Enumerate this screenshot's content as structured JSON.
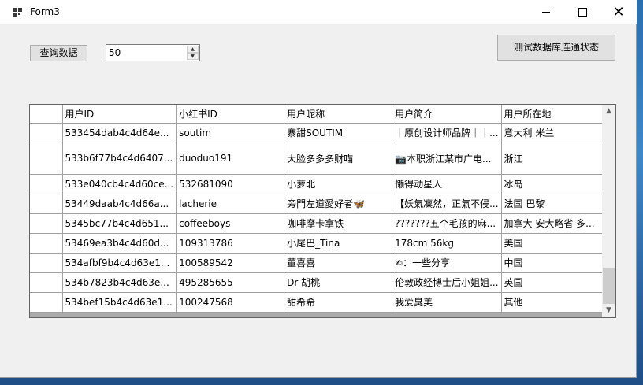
{
  "window": {
    "title": "Form3",
    "controls": {
      "minimize": "—",
      "maximize": "☐",
      "close": "✕"
    }
  },
  "toolbar": {
    "query_label": "查询数据",
    "count_value": "50",
    "test_label": "测试数据库连通状态"
  },
  "grid": {
    "columns": [
      "用户ID",
      "小红书ID",
      "用户昵称",
      "用户简介",
      "用户所在地"
    ],
    "rows": [
      [
        "533454dab4c4d64e...",
        "soutim",
        "寨甜SOUTIM",
        "｜原创设计师品牌｜｜...",
        "意大利  米兰"
      ],
      [
        "533b6f77b4c4d6407...",
        "duoduo191",
        "大脸多多多财喵",
        "📷本职浙江某市广电...",
        "浙江"
      ],
      [
        "533e040cb4c4d60ce...",
        "532681090",
        "小萝北",
        "懒得动星人",
        "冰岛"
      ],
      [
        "53449daab4c4d66a...",
        "lacherie",
        "旁門左道愛好者🦋",
        "【妖氣凜然，正氣不侵...",
        "法国  巴黎"
      ],
      [
        "5345bc77b4c4d651...",
        "coffeeboys",
        "咖啡摩卡拿铁",
        "???????五个毛孩的麻...",
        "加拿大  安大略省  多..."
      ],
      [
        "53469ea3b4c4d60d...",
        "109313786",
        "小尾巴_Tina",
        "178cm 56kg",
        "美国"
      ],
      [
        "534afbf9b4c4d63e1...",
        "100589542",
        "董喜喜",
        "✍：一些分享",
        "中国"
      ],
      [
        "534b7823b4c4d63e...",
        "495285655",
        "Dr 胡桃",
        "伦敦政经博士后小姐姐...",
        "英国"
      ],
      [
        "534bef15b4c4d63e1...",
        "100247568",
        "甜希希",
        "我爱臭美",
        "其他"
      ]
    ]
  },
  "scrollbar": {
    "up": "▲",
    "down": "▼"
  }
}
